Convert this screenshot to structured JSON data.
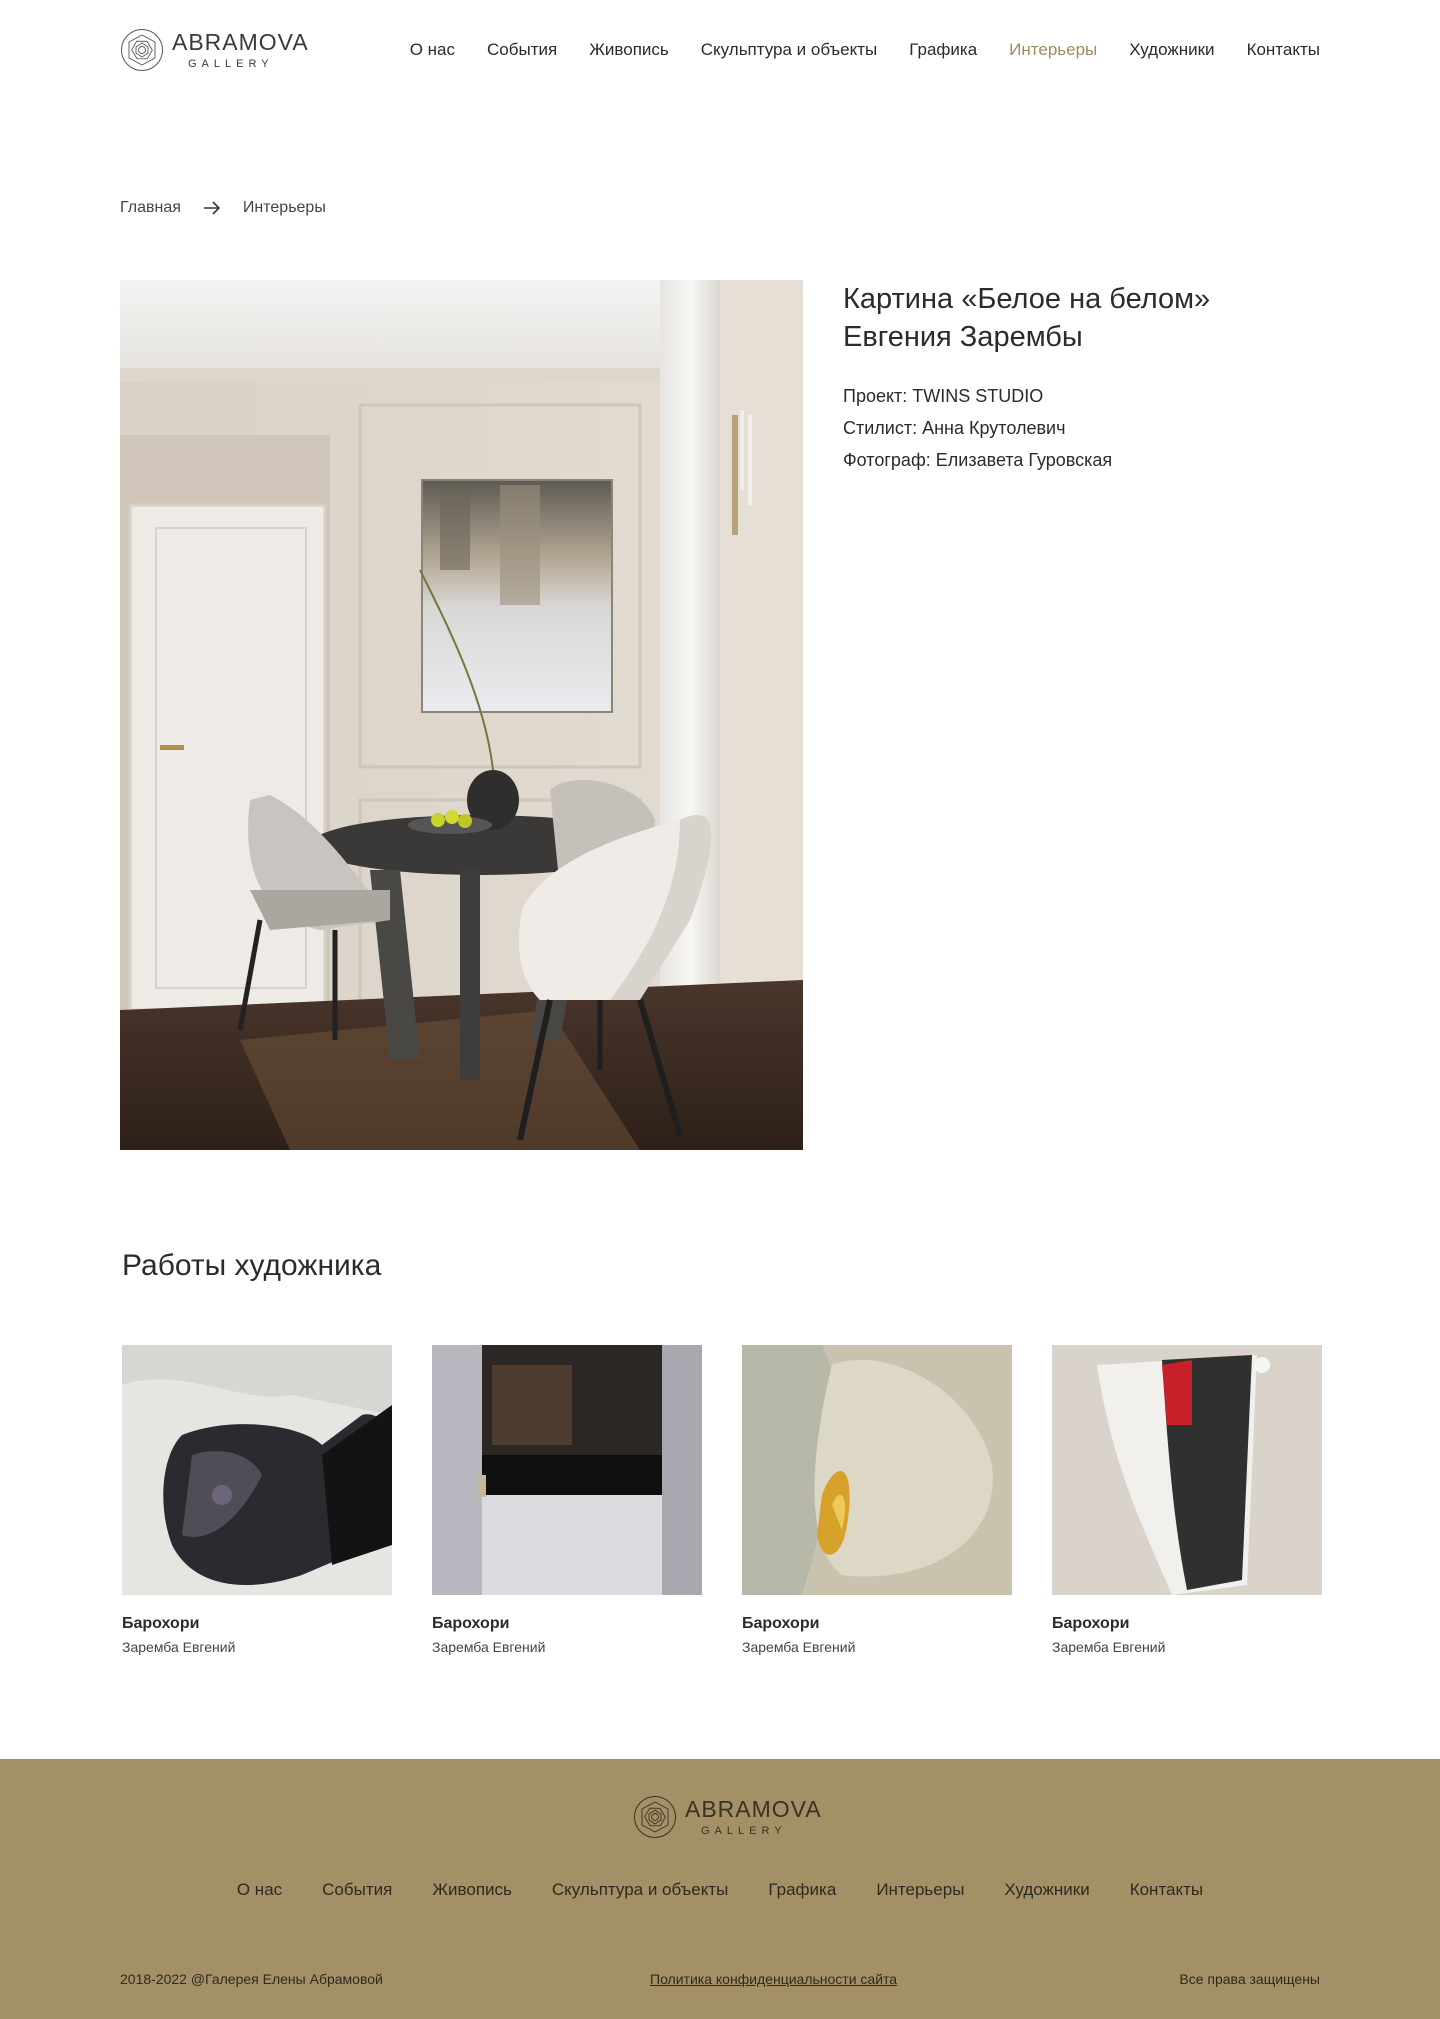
{
  "brand": {
    "name": "ABRAMOVA",
    "sub": "GALLERY"
  },
  "nav": [
    {
      "label": "О нас"
    },
    {
      "label": "События"
    },
    {
      "label": "Живопись"
    },
    {
      "label": "Скульптура и объекты"
    },
    {
      "label": "Графика"
    },
    {
      "label": "Интерьеры",
      "active": true
    },
    {
      "label": "Художники"
    },
    {
      "label": "Контакты"
    }
  ],
  "breadcrumb": {
    "home": "Главная",
    "current": "Интерьеры"
  },
  "artwork": {
    "title": "Картина «Белое на белом» Евгения Зарембы",
    "project": "Проект: TWINS STUDIO",
    "stylist": "Стилист: Анна Крутолевич",
    "photographer": "Фотограф: Елизавета Гуровская"
  },
  "works": {
    "title": "Работы художника",
    "items": [
      {
        "title": "Барохори",
        "author": "Заремба Евгений"
      },
      {
        "title": "Барохори",
        "author": "Заремба Евгений"
      },
      {
        "title": "Барохори",
        "author": "Заремба Евгений"
      },
      {
        "title": "Барохори",
        "author": "Заремба Евгений"
      }
    ]
  },
  "footer": {
    "copyright": "2018-2022 @Галерея Елены Абрамовой",
    "privacy": "Политика конфиденциальности сайта",
    "rights": "Все права защищены"
  },
  "colors": {
    "accent": "#a08c5f",
    "footer_bg": "#a39066",
    "text": "#2b2b2b"
  }
}
